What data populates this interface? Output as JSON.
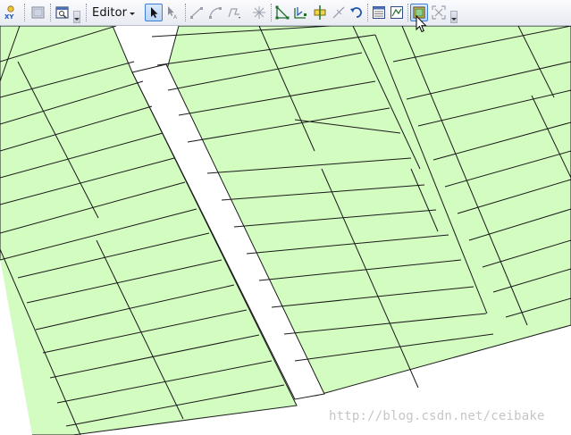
{
  "toolbar": {
    "editor_menu_label": "Editor",
    "buttons": [
      {
        "icon": "go-to-xy-icon"
      },
      {
        "icon": "magnifier-window-icon"
      },
      {
        "icon": "viewer-window-icon"
      },
      {
        "icon": "edit-tool-icon"
      },
      {
        "icon": "edit-annotation-tool-icon"
      },
      {
        "icon": "straight-segment-icon"
      },
      {
        "icon": "endpoint-arc-segment-icon"
      },
      {
        "icon": "trace-icon"
      },
      {
        "icon": "point-icon"
      },
      {
        "icon": "edit-vertices-icon"
      },
      {
        "icon": "reshape-feature-icon"
      },
      {
        "icon": "cut-polygons-icon"
      },
      {
        "icon": "split-tool-icon"
      },
      {
        "icon": "rotate-tool-icon"
      },
      {
        "icon": "attributes-icon"
      },
      {
        "icon": "sketch-properties-icon"
      },
      {
        "icon": "topology-edit-icon"
      },
      {
        "icon": "full-extent-icon"
      }
    ]
  },
  "map": {
    "parcel_fill": "#d2fcc0",
    "parcel_stroke": "#1a1a1a",
    "background": "#ffffff"
  },
  "watermark": "http://blog.csdn.net/ceibake"
}
